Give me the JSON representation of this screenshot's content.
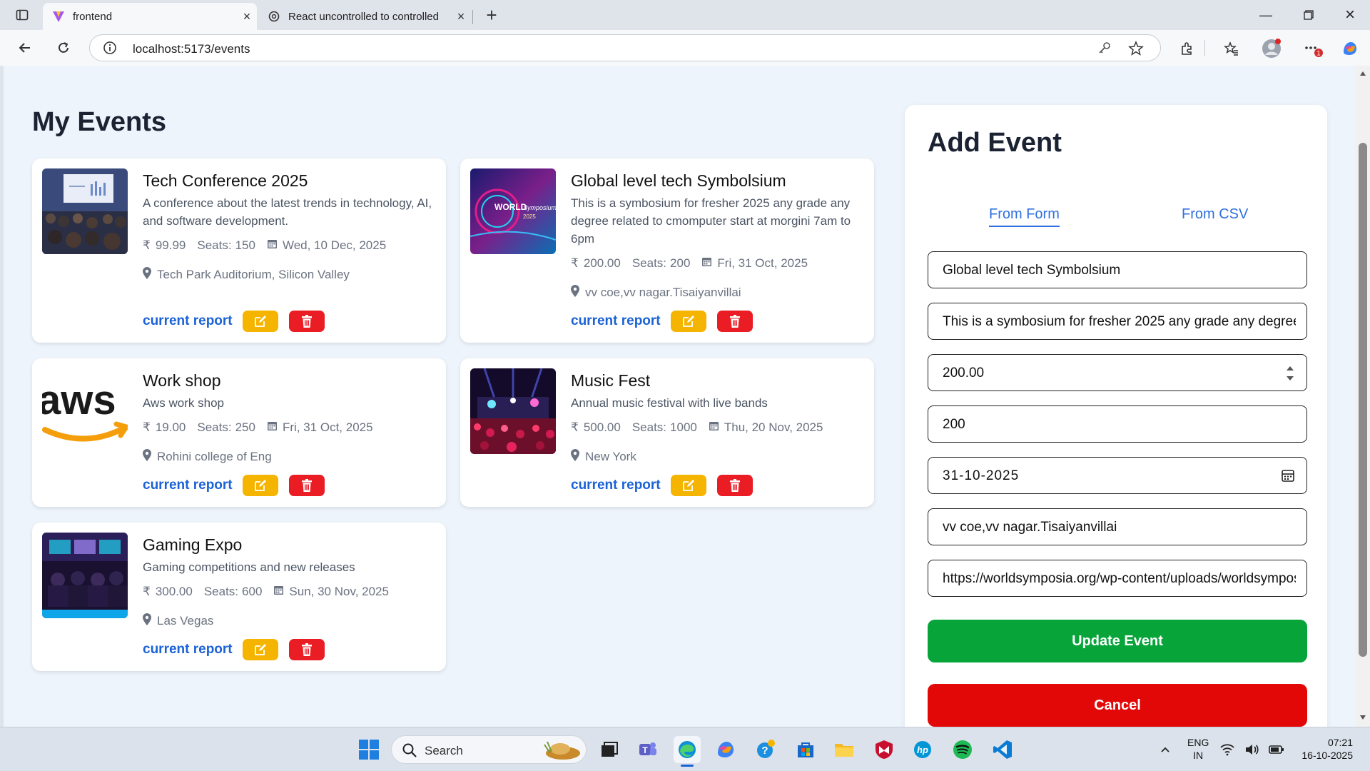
{
  "browser": {
    "tabs": [
      {
        "title": "frontend",
        "active": true
      },
      {
        "title": "React uncontrolled to controlled",
        "active": false
      }
    ],
    "url": "localhost:5173/events"
  },
  "page": {
    "heading": "My Events",
    "report_label": "current report",
    "currency": "₹",
    "seats_prefix": "Seats:",
    "events": [
      {
        "title": "Tech Conference 2025",
        "description": "A conference about the latest trends in technology, AI, and software development.",
        "price": "99.99",
        "seats": "150",
        "date": "Wed, 10 Dec, 2025",
        "location": "Tech Park Auditorium, Silicon Valley",
        "thumb": "conference-photo"
      },
      {
        "title": "Global level tech Symbolsium",
        "description": "This is a symbosium for fresher 2025 any grade any degree related to cmomputer start at morgini 7am to 6pm",
        "price": "200.00",
        "seats": "200",
        "date": "Fri, 31 Oct, 2025",
        "location": "vv coe,vv nagar.Tisaiyanvillai",
        "thumb": "world-symposium-banner"
      },
      {
        "title": "Work shop",
        "description": "Aws work shop",
        "price": "19.00",
        "seats": "250",
        "date": "Fri, 31 Oct, 2025",
        "location": "Rohini college of Eng",
        "thumb": "aws-logo"
      },
      {
        "title": "Music Fest",
        "description": "Annual music festival with live bands",
        "price": "500.00",
        "seats": "1000",
        "date": "Thu, 20 Nov, 2025",
        "location": "New York",
        "thumb": "concert-photo"
      },
      {
        "title": "Gaming Expo",
        "description": "Gaming competitions and new releases",
        "price": "300.00",
        "seats": "600",
        "date": "Sun, 30 Nov, 2025",
        "location": "Las Vegas",
        "thumb": "gaming-photo"
      }
    ]
  },
  "form": {
    "title": "Add Event",
    "tabs": [
      "From Form",
      "From CSV"
    ],
    "active_tab": "From Form",
    "fields": {
      "title": "Global level tech Symbolsium",
      "description": "This is a symbosium for fresher 2025 any grade any degree related to cmomputer start at morgini 7am to 6pm",
      "price": "200.00",
      "seats": "200",
      "date": "31-10-2025",
      "location": "vv coe,vv nagar.Tisaiyanvillai",
      "image_url": "https://worldsymposia.org/wp-content/uploads/worldsymposium"
    },
    "update_label": "Update Event",
    "cancel_label": "Cancel"
  },
  "taskbar": {
    "search_label": "Search",
    "lang_top": "ENG",
    "lang_bottom": "IN",
    "time": "07:21",
    "date": "16-10-2025"
  },
  "colors": {
    "accent_blue": "#1a62d6",
    "edit_yellow": "#f5b400",
    "delete_red": "#ea1c24",
    "update_green": "#07a43a",
    "cancel_red": "#e30808",
    "page_bg": "#eef4fb"
  },
  "icons": [
    "rupee-icon",
    "calendar-icon",
    "location-pin-icon",
    "edit-icon",
    "trash-icon",
    "spinner-arrows-icon"
  ]
}
